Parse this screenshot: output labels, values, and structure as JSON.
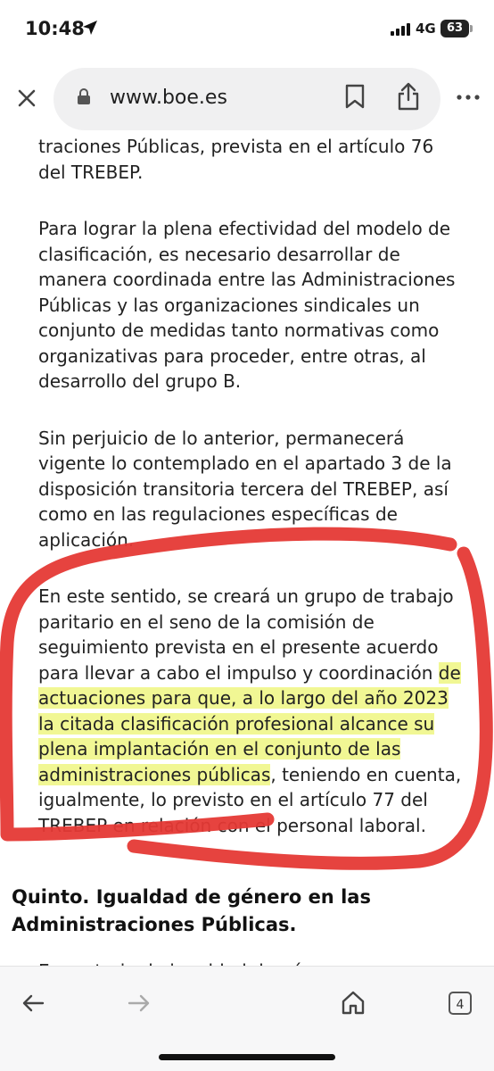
{
  "status_bar": {
    "time": "10:48",
    "network": "4G",
    "battery": "63"
  },
  "browser": {
    "url": "www.boe.es"
  },
  "article": {
    "p1": "traciones Públicas, prevista en el artículo 76 del TREBEP.",
    "p2": "Para lograr la plena efectividad del modelo de clasificación, es necesario desarrollar de manera coordinada entre las Administraciones Públicas y las organizaciones sindicales un conjunto de medidas tanto normativas como organizativas para proceder, entre otras, al desarrollo del grupo B.",
    "p3": "Sin perjuicio de lo anterior, permanecerá vigente lo contemplado en el apartado 3 de la disposición transitoria tercera del TREBEP, así como en las regulaciones específicas de aplicación.",
    "p4_before": "En este sentido, se creará un grupo de trabajo paritario en el seno de la comisión de seguimiento prevista en el presente acuerdo para llevar a cabo el impulso y coordinación ",
    "p4_highlight": "de actuaciones para que, a lo largo del año 2023 la citada clasificación profesional alcance su plena implantación en el conjunto de las administraciones públicas",
    "p4_after": ", teniendo en cuenta, igualmente, lo previsto en el artículo 77 del TREBEP en relación con el personal laboral.",
    "heading": "Quinto.   Igualdad de género en las Administraciones Públicas.",
    "next_line": "En materia de igualdad de género, se dispondrá"
  },
  "toolbar": {
    "tab_count": "4"
  },
  "annotation_color": "#e53935",
  "highlight_color": "#e6f03c"
}
